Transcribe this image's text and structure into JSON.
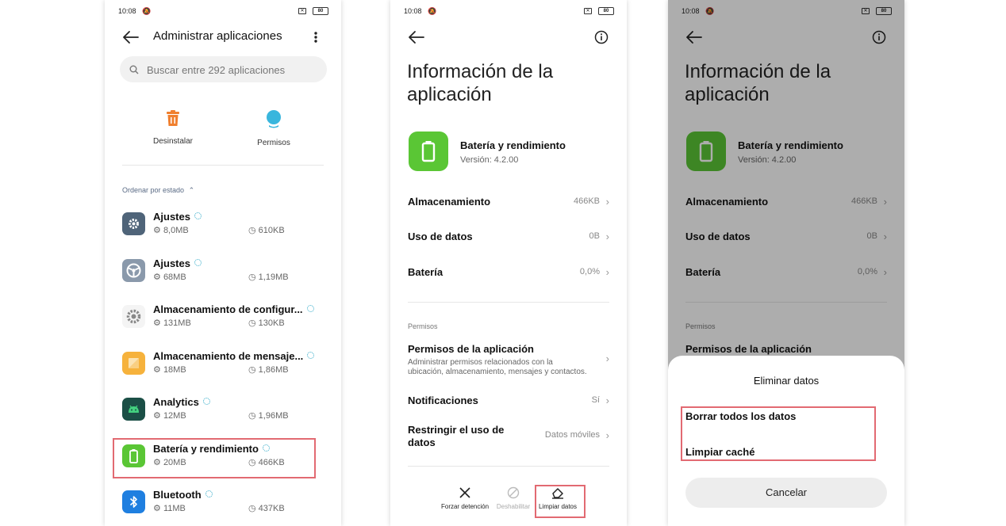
{
  "status": {
    "time": "10:08",
    "battery": "80"
  },
  "colors": {
    "highlight": "#e26a72",
    "battery_app": "#5ac635",
    "accent": "#2aa7c6"
  },
  "screen1": {
    "title": "Administrar aplicaciones",
    "search_placeholder": "Buscar entre 292 aplicaciones",
    "actions": [
      {
        "label": "Desinstalar",
        "icon": "trash-icon"
      },
      {
        "label": "Permisos",
        "icon": "permissions-icon"
      }
    ],
    "sort_label": "Ordenar por estado",
    "apps": [
      {
        "name": "Ajustes",
        "size": "8,0MB",
        "cache": "610KB",
        "icon": "gear-icon"
      },
      {
        "name": "Ajustes",
        "size": "68MB",
        "cache": "1,19MB",
        "icon": "steering-icon"
      },
      {
        "name": "Almacenamiento de configur...",
        "size": "131MB",
        "cache": "130KB",
        "icon": "cog-gray-icon"
      },
      {
        "name": "Almacenamiento de mensaje...",
        "size": "18MB",
        "cache": "1,86MB",
        "icon": "message-storage-icon"
      },
      {
        "name": "Analytics",
        "size": "12MB",
        "cache": "1,96MB",
        "icon": "android-icon"
      },
      {
        "name": "Batería y rendimiento",
        "size": "20MB",
        "cache": "466KB",
        "icon": "battery-icon"
      },
      {
        "name": "Bluetooth",
        "size": "11MB",
        "cache": "437KB",
        "icon": "bluetooth-icon"
      }
    ]
  },
  "screen2": {
    "title_line1": "Información de la",
    "title_line2": "aplicación",
    "app_name": "Batería y rendimiento",
    "app_version": "Versión: 4.2.00",
    "rows": [
      {
        "label": "Almacenamiento",
        "value": "466KB"
      },
      {
        "label": "Uso de datos",
        "value": "0B"
      },
      {
        "label": "Batería",
        "value": "0,0%"
      }
    ],
    "permissions_section": "Permisos",
    "perm_title": "Permisos de la aplicación",
    "perm_desc": "Administrar permisos relacionados con la ubicación, almacenamiento, mensajes y contactos.",
    "notifications": {
      "label": "Notificaciones",
      "value": "Sí"
    },
    "restrict": {
      "label_line1": "Restringir el uso de",
      "label_line2": "datos",
      "value": "Datos móviles"
    },
    "bottom": [
      {
        "label": "Forzar detención"
      },
      {
        "label": "Deshabilitar"
      },
      {
        "label": "Limpiar datos"
      }
    ]
  },
  "screen3": {
    "sheet_title": "Eliminar datos",
    "option1": "Borrar todos los datos",
    "option2": "Limpiar caché",
    "cancel": "Cancelar"
  }
}
